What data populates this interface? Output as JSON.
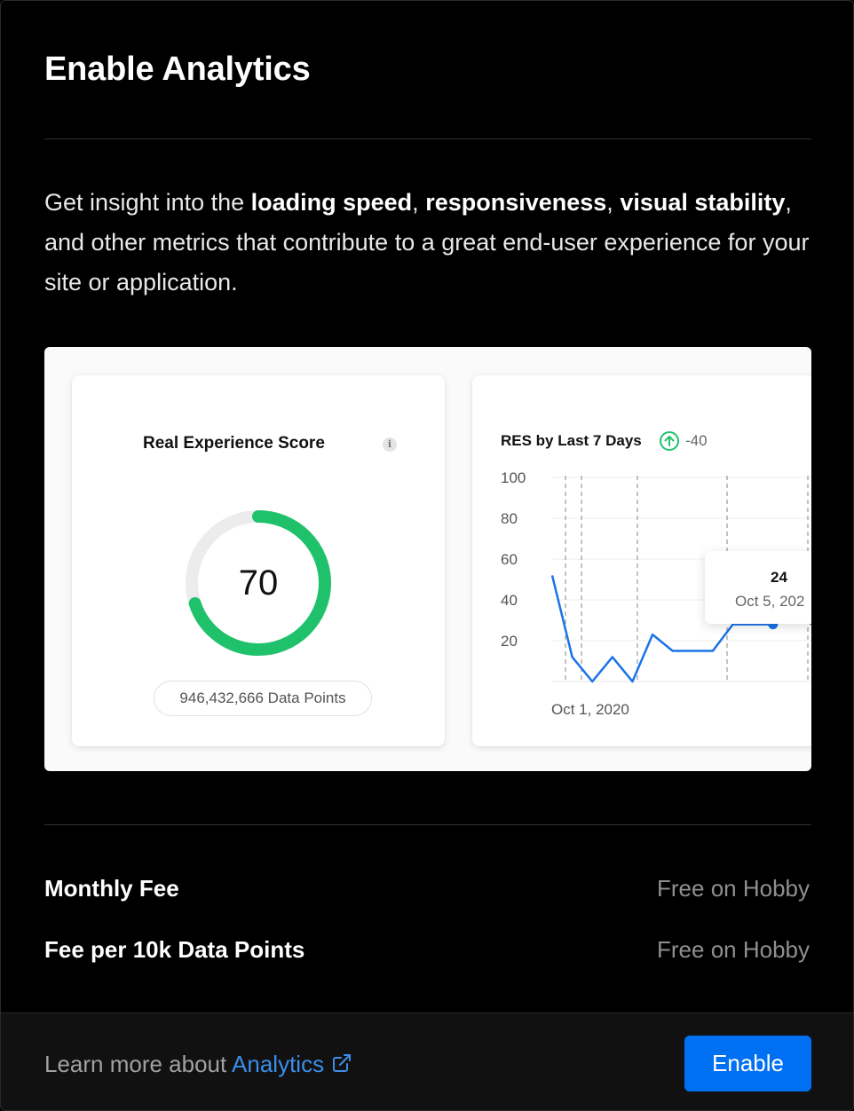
{
  "modal": {
    "title": "Enable Analytics",
    "description": {
      "t1": "Get insight into the ",
      "b1": "loading speed",
      "t2": ", ",
      "b2": "responsiveness",
      "t3": ", ",
      "b3": "visual stability",
      "t4": ", and other metrics that contribute to a great end-user experience for your site or application."
    }
  },
  "preview": {
    "score_card": {
      "title": "Real Experience Score",
      "info_icon": "info-icon",
      "score": "70",
      "score_fraction": 0.7,
      "gauge_color": "#1fc26b",
      "data_points": "946,432,666 Data Points"
    },
    "res_card": {
      "title": "RES by Last 7 Days",
      "delta_icon": "arrow-up-circle-icon",
      "delta": "-40",
      "tooltip_value": "24",
      "tooltip_date": "Oct 5, 202",
      "chart_data": {
        "type": "line",
        "title": "RES by Last 7 Days",
        "xlabel": "",
        "ylabel": "",
        "ylim": [
          0,
          100
        ],
        "yticks": [
          "100",
          "80",
          "60",
          "40",
          "20"
        ],
        "x_tick_label": "Oct 1, 2020",
        "grid": true,
        "series": [
          {
            "values": [
              52,
              12,
              0,
              12,
              0,
              23,
              15,
              15,
              15,
              28,
              28,
              28,
              32,
              28
            ]
          }
        ],
        "highlight_index": 11,
        "line_color": "#1a73e8"
      }
    }
  },
  "fees": [
    {
      "label": "Monthly Fee",
      "value": "Free on Hobby"
    },
    {
      "label": "Fee per 10k Data Points",
      "value": "Free on Hobby"
    }
  ],
  "footer": {
    "learn_prefix": "Learn more about ",
    "learn_link": "Analytics",
    "link_icon": "external-link-icon",
    "enable_label": "Enable",
    "accent": "#0070f3"
  }
}
